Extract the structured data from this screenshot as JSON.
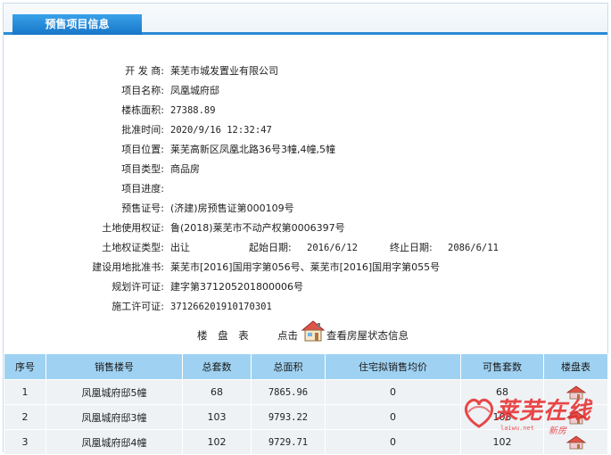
{
  "header": {
    "tab_label": "预售项目信息"
  },
  "project": {
    "developer_label": "开 发 商:",
    "developer": "莱芜市城发置业有限公司",
    "name_label": "项目名称:",
    "name": "凤凰城府邸",
    "area_label": "楼栋面积:",
    "area": "27388.89",
    "approve_time_label": "批准时间:",
    "approve_time": "2020/9/16 12:32:47",
    "location_label": "项目位置:",
    "location": "莱芜高新区凤凰北路36号3幢,4幢,5幢",
    "type_label": "项目类型:",
    "type": "商品房",
    "progress_label": "项目进度:",
    "progress": "",
    "presale_cert_label": "预售证号:",
    "presale_cert": "(济建)房预售证第000109号",
    "land_cert_label": "土地使用权证:",
    "land_cert": "鲁(2018)莱芜市不动产权第0006397号",
    "land_right_type_label": "土地权证类型:",
    "land_right_type": "出让",
    "start_date_label": "起始日期:",
    "start_date": "2016/6/12",
    "end_date_label": "终止日期:",
    "end_date": "2086/6/11",
    "land_approval_label": "建设用地批准书:",
    "land_approval": "莱芜市[2016]国用字第056号、莱芜市[2016]国用字第055号",
    "planning_permit_label": "规划许可证:",
    "planning_permit": "建字第371205201800006号",
    "construction_permit_label": "施工许可证:",
    "construction_permit": "371266201910170301"
  },
  "floor_plan": {
    "title": "楼 盘 表",
    "click_label": "点击",
    "link_label": "查看房屋状态信息"
  },
  "table": {
    "headers": [
      "序号",
      "销售楼号",
      "总套数",
      "总面积",
      "住宅拟销售均价",
      "可售套数",
      "楼盘表"
    ],
    "rows": [
      [
        "1",
        "凤凰城府邸5幢",
        "68",
        "7865.96",
        "0",
        "68"
      ],
      [
        "2",
        "凤凰城府邸3幢",
        "103",
        "9793.22",
        "0",
        "103"
      ],
      [
        "3",
        "凤凰城府邸4幢",
        "102",
        "9729.71",
        "0",
        "102"
      ]
    ]
  },
  "watermark": {
    "brand": "莱芜在线",
    "site": "laiwu.net",
    "tag": "新房"
  },
  "icons": {
    "house": "house-icon"
  }
}
